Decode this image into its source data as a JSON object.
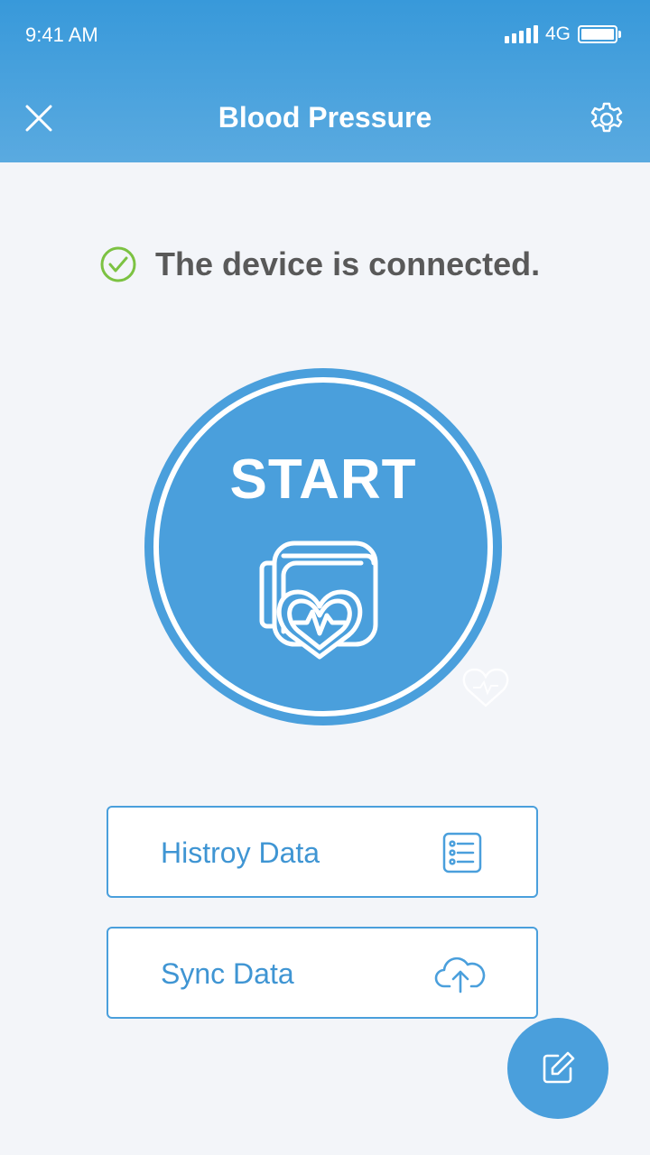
{
  "status_bar": {
    "time": "9:41 AM",
    "network": "4G"
  },
  "header": {
    "title": "Blood Pressure",
    "close_icon": "close-icon",
    "settings_icon": "gear-icon"
  },
  "connection": {
    "text": "The device is connected.",
    "icon": "check-circle-icon",
    "color": "#7cc242"
  },
  "start": {
    "label": "START",
    "icon": "blood-pressure-cuff-icon"
  },
  "actions": [
    {
      "label": "Histroy Data",
      "icon": "list-icon"
    },
    {
      "label": "Sync Data",
      "icon": "cloud-upload-icon"
    }
  ],
  "fab": {
    "icon": "edit-icon"
  },
  "colors": {
    "accent": "#4a9fdc",
    "header_top": "#3899da",
    "header_bottom": "#5aaae0",
    "text_dark": "#595959"
  }
}
